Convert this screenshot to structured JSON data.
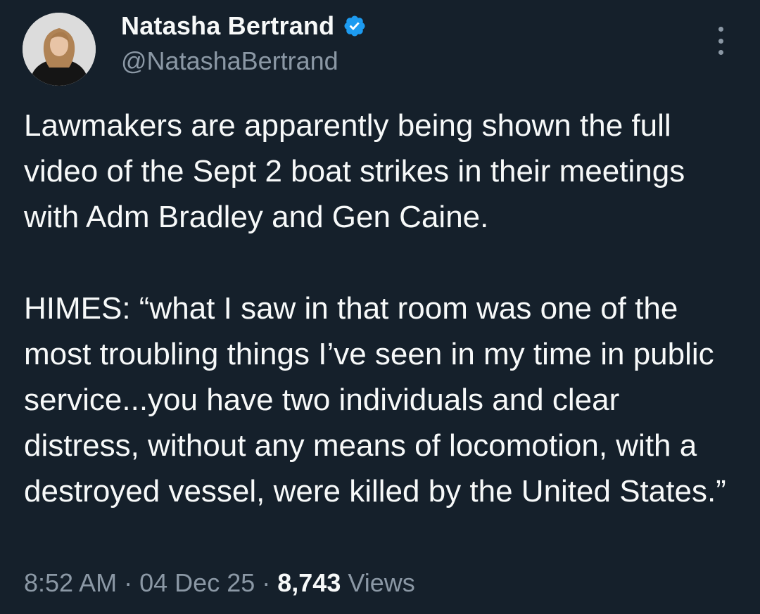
{
  "author": {
    "display_name": "Natasha Bertrand",
    "handle": "@NatashaBertrand",
    "verified": true,
    "avatar_icon": "profile-photo",
    "verified_icon": "verified-badge-icon"
  },
  "tweet": {
    "paragraphs": [
      "Lawmakers are apparently being shown the full video of the Sept 2 boat strikes in their meetings with Adm Bradley and Gen Caine.",
      "HIMES: “what I saw in that room was one of the most troubling things I’ve seen in my time in public service...you have two individuals and clear distress, without any means of locomotion, with a destroyed vessel, were killed by the United States.”"
    ]
  },
  "meta": {
    "time": "8:52 AM",
    "separator": "·",
    "date": "04 Dec 25",
    "views_count": "8,743",
    "views_label": "Views"
  },
  "colors": {
    "background": "#15202b",
    "primary_text": "#f7f9f9",
    "secondary_text": "#8b98a5",
    "verified_blue": "#1d9bf0"
  },
  "icons": {
    "more": "more-options-icon"
  }
}
